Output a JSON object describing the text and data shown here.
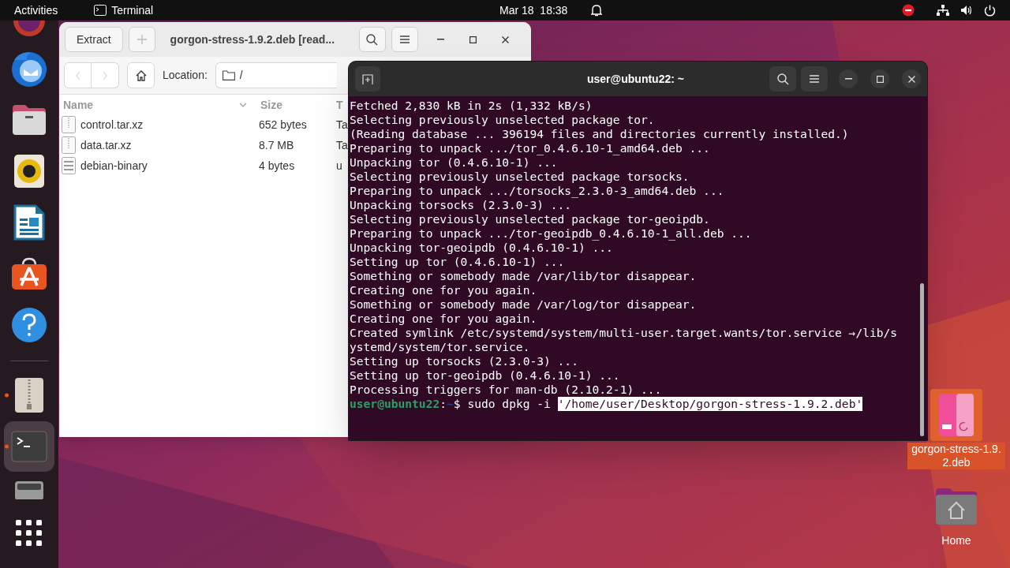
{
  "top_bar": {
    "activities": "Activities",
    "app_name": "Terminal",
    "date": "Mar 18",
    "time": "18:38"
  },
  "dock": [
    {
      "kind": "browser",
      "running": false,
      "selected": false
    },
    {
      "kind": "mail",
      "running": false,
      "selected": false
    },
    {
      "kind": "files",
      "running": false,
      "selected": false
    },
    {
      "kind": "music",
      "running": false,
      "selected": false
    },
    {
      "kind": "writer",
      "running": false,
      "selected": false
    },
    {
      "kind": "store",
      "running": false,
      "selected": false
    },
    {
      "kind": "help",
      "running": false,
      "selected": false
    },
    {
      "kind": "archive",
      "running": true,
      "selected": false
    },
    {
      "kind": "terminal",
      "running": true,
      "selected": true
    },
    {
      "kind": "drive",
      "running": false,
      "selected": false
    },
    {
      "kind": "apps",
      "running": false,
      "selected": false
    }
  ],
  "archive_window": {
    "extract_button": "Extract",
    "title": "gorgon-stress-1.9.2.deb [read...",
    "location_label": "Location:",
    "location": "/",
    "columns": [
      "Name",
      "Size",
      "T"
    ],
    "rows": [
      {
        "name": "control.tar.xz",
        "kind": "archive",
        "size": "652 bytes",
        "column_3": "Ta"
      },
      {
        "name": "data.tar.xz",
        "kind": "archive",
        "size": "8.7 MB",
        "column_3": "Ta"
      },
      {
        "name": "debian-binary",
        "kind": "binary",
        "size": "4 bytes",
        "column_3": "u"
      }
    ]
  },
  "terminal": {
    "title": "user@ubuntu22: ~",
    "lines": [
      "Fetched 2,830 kB in 2s (1,332 kB/s)",
      "Selecting previously unselected package tor.",
      "(Reading database ... 396194 files and directories currently installed.)",
      "Preparing to unpack .../tor_0.4.6.10-1_amd64.deb ...",
      "Unpacking tor (0.4.6.10-1) ...",
      "Selecting previously unselected package torsocks.",
      "Preparing to unpack .../torsocks_2.3.0-3_amd64.deb ...",
      "Unpacking torsocks (2.3.0-3) ...",
      "Selecting previously unselected package tor-geoipdb.",
      "Preparing to unpack .../tor-geoipdb_0.4.6.10-1_all.deb ...",
      "Unpacking tor-geoipdb (0.4.6.10-1) ...",
      "Setting up tor (0.4.6.10-1) ...",
      "Something or somebody made /var/lib/tor disappear.",
      "Creating one for you again.",
      "Something or somebody made /var/log/tor disappear.",
      "Creating one for you again.",
      "Created symlink /etc/systemd/system/multi-user.target.wants/tor.service →/lib/s",
      "ystemd/system/tor.service.",
      "Setting up torsocks (2.3.0-3) ...",
      "Setting up tor-geoipdb (0.4.6.10-1) ...",
      "Processing triggers for man-db (2.10.2-1) ..."
    ],
    "prompt": {
      "user_host": "user@ubuntu22",
      "separator": ":",
      "path": "~",
      "symbol": "$",
      "command": "sudo dpkg -i",
      "selection": "'/home/user/Desktop/gorgon-stress-1.9.2.deb'"
    }
  },
  "desktop_icons": [
    {
      "label": "gorgon-stress-1.9.2.deb",
      "kind": "deb",
      "selected": true
    },
    {
      "label": "Home",
      "kind": "folder",
      "selected": false
    }
  ]
}
